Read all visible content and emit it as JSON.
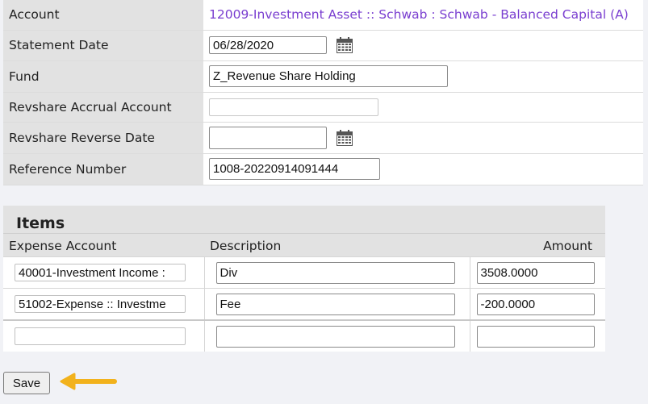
{
  "form": {
    "account_label": "Account",
    "account_value": "12009-Investment Asset :: Schwab : Schwab - Balanced Capital (A)",
    "statement_date_label": "Statement Date",
    "statement_date_value": "06/28/2020",
    "fund_label": "Fund",
    "fund_value": "Z_Revenue Share Holding",
    "revshare_accrual_label": "Revshare Accrual Account",
    "revshare_accrual_value": "",
    "revshare_reverse_date_label": "Revshare Reverse Date",
    "revshare_reverse_date_value": "",
    "reference_number_label": "Reference Number",
    "reference_number_value": "1008-20220914091444",
    "calendar_icon": "calendar-icon"
  },
  "items": {
    "title": "Items",
    "columns": {
      "expense_account": "Expense Account",
      "description": "Description",
      "amount": "Amount"
    },
    "rows": [
      {
        "expense_account": "40001-Investment Income :",
        "description": "Div",
        "amount": "3508.0000"
      },
      {
        "expense_account": "51002-Expense :: Investme",
        "description": "Fee",
        "amount": "-200.0000"
      },
      {
        "expense_account": "",
        "description": "",
        "amount": ""
      }
    ]
  },
  "actions": {
    "save_label": "Save",
    "arrow_color": "#f2b21c",
    "arrow_icon": "left-arrow-icon"
  },
  "colors": {
    "link": "#7a3fd0",
    "label_bg": "#e2e2e2",
    "page_bg": "#f1f2f6"
  }
}
